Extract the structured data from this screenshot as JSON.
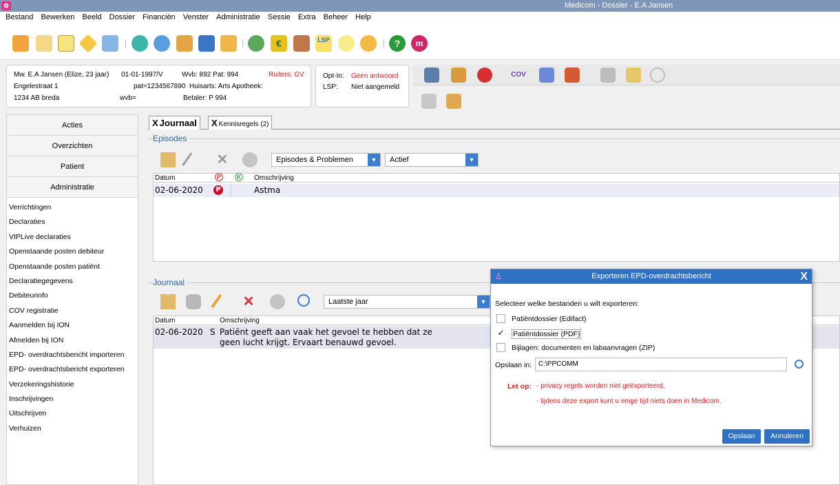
{
  "window": {
    "title": "Medicom - Dossier - E.A Jansen",
    "app_icon": "medicom-logo-icon"
  },
  "menu": [
    "Bestand",
    "Bewerken",
    "Beeld",
    "Dossier",
    "Financiën",
    "Venster",
    "Administratie",
    "Sessie",
    "Extra",
    "Beheer",
    "Help"
  ],
  "patient": {
    "name": "Mw. E.A Jansen (Elize, 23 jaar)",
    "dob": "01-01-1997/V",
    "address": "Engelestraat 1",
    "pat_nr": "pat=1234567890",
    "postcode_city": "1234 AB breda",
    "wvb_label": "wvb=",
    "wvb_pat": "Wvb: 892 Pat: 994",
    "ruiters": "Ruiters: GV",
    "huisarts": "Huisarts: Arts Apotheek:",
    "betaler": "Betaler: P 994"
  },
  "optin": {
    "optin_label": "Opt-In:",
    "optin_value": "Geen antwoord",
    "lsp_label": "LSP:",
    "lsp_value": "Niet aangemeld"
  },
  "sidebar": {
    "sections": [
      "Acties",
      "Overzichten",
      "Patient",
      "Administratie"
    ],
    "items": [
      "Verrichtingen",
      "Declaraties",
      "VIPLive declaraties",
      "Openstaande posten debiteur",
      "Openstaande posten patiënt",
      "Declaratiegegevens",
      "Debiteurinfo",
      "COV registratie",
      "Aanmelden bij ION",
      "Afmelden bij ION",
      "EPD- overdrachtsbericht importeren",
      "EPD- overdrachtsbericht exporteren",
      "Verzekeringshistorie",
      "Inschrijvingen",
      "Uitschrijven",
      "Verhuizen"
    ]
  },
  "tabs": [
    {
      "label": "Journaal",
      "close": "X"
    },
    {
      "label": "Kennisregels (2)",
      "close": "X"
    }
  ],
  "episodes": {
    "label": "Episodes",
    "filter_type": "Episodes & Problemen",
    "filter_status": "Actief",
    "columns": [
      "Datum",
      "Omschrijving"
    ],
    "rows": [
      {
        "date": "02-06-2020",
        "badge": "P",
        "text": "Astma"
      }
    ],
    "col_p": "P",
    "col_k": "K"
  },
  "journaal": {
    "label": "Journaal",
    "filter_period": "Laatste jaar",
    "columns": [
      "Datum",
      "Omschrijving"
    ],
    "rows": [
      {
        "date": "02-06-2020",
        "type": "S",
        "line1": "Patiënt geeft aan vaak het gevoel te hebben dat ze",
        "line2": "geen lucht krijgt. Ervaart benauwd gevoel."
      }
    ]
  },
  "dialog": {
    "title": "Exporteren EPD-overdrachtsbericht",
    "close": "X",
    "prompt": "Selecteer welke bestanden u wilt exporteren:",
    "options": [
      {
        "label": "Patiëntdossier (Edifact)",
        "checked": false
      },
      {
        "label": "Patiëntdossier (PDF)",
        "checked": true
      },
      {
        "label": "Bijlagen: documenten en labaanvragen (ZIP)",
        "checked": false
      }
    ],
    "check_mark": "✓",
    "save_label": "Opslaan in:",
    "save_path": "C:\\PPCOMM",
    "warning_label": "Let op:",
    "warning1": "- privacy regels worden niet geëxporteerd.",
    "warning2": "- tijdens deze export kunt u enige tijd niets doen in Medicom.",
    "btn_save": "Opslaan",
    "btn_cancel": "Annuleren"
  }
}
